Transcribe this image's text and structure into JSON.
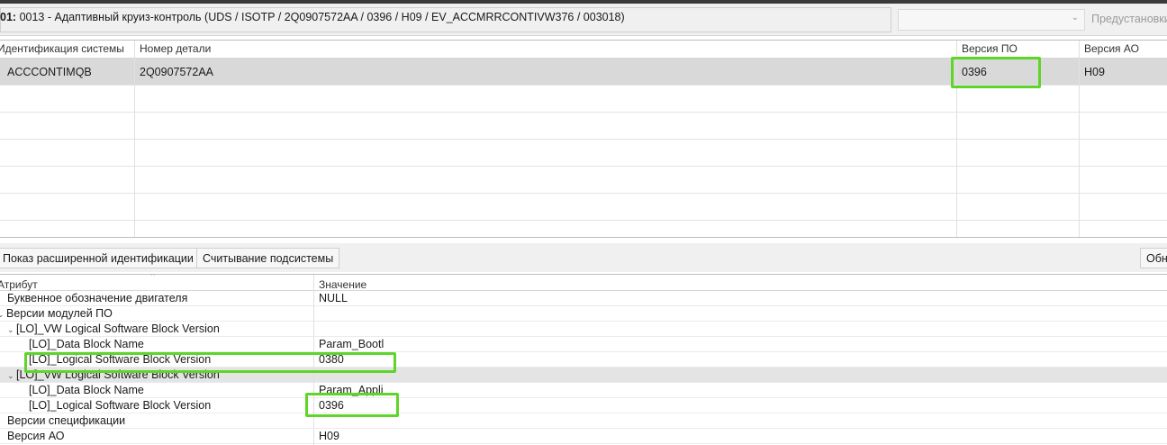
{
  "title": {
    "prefix": "01:",
    "text": "0013 - Адаптивный круиз-контроль  (UDS / ISOTP / 2Q0907572AA / 0396 / H09 / EV_ACCMRRCONTIVW376 / 003018)",
    "preset_button": "Предустановки"
  },
  "system_table": {
    "columns": [
      "Идентификация системы",
      "Номер детали",
      "Версия ПО",
      "Версия АО"
    ],
    "rows": [
      {
        "system": "ACCCONTIMQB",
        "part_number": "2Q0907572AA",
        "sw_version": "0396",
        "hw_version": "H09"
      }
    ]
  },
  "buttons": {
    "extended_id": "Показ расширенной идентификации",
    "read_subsystem": "Считывание подсистемы",
    "refresh": "Обн"
  },
  "attr_table": {
    "columns": [
      "Атрибут",
      "Значение"
    ],
    "rows": [
      {
        "attr": "Буквенное обозначение двигателя",
        "value": "NULL",
        "level": 0,
        "expander": ""
      },
      {
        "attr": "Версии модулей ПО",
        "value": "",
        "level": 0,
        "expander": "⌄"
      },
      {
        "attr": "[LO]_VW Logical Software Block Version",
        "value": "",
        "level": 1,
        "expander": "⌄"
      },
      {
        "attr": "[LO]_Data Block Name",
        "value": "Param_Bootl",
        "level": 2,
        "expander": ""
      },
      {
        "attr": "[LO]_Logical Software Block Version",
        "value": "0380",
        "level": 2,
        "expander": ""
      },
      {
        "attr": "[LO]_VW Logical Software Block Version",
        "value": "",
        "level": 1,
        "expander": "⌄"
      },
      {
        "attr": "[LO]_Data Block Name",
        "value": "Param_Appli",
        "level": 2,
        "expander": ""
      },
      {
        "attr": "[LO]_Logical Software Block Version",
        "value": "0396",
        "level": 2,
        "expander": ""
      },
      {
        "attr": "Версии спецификации",
        "value": "",
        "level": 0,
        "expander": ""
      },
      {
        "attr": "Версия АО",
        "value": "H09",
        "level": 0,
        "expander": ""
      }
    ]
  },
  "colors": {
    "highlight": "#5fd52a",
    "selected_row": "#d9d9d9"
  }
}
